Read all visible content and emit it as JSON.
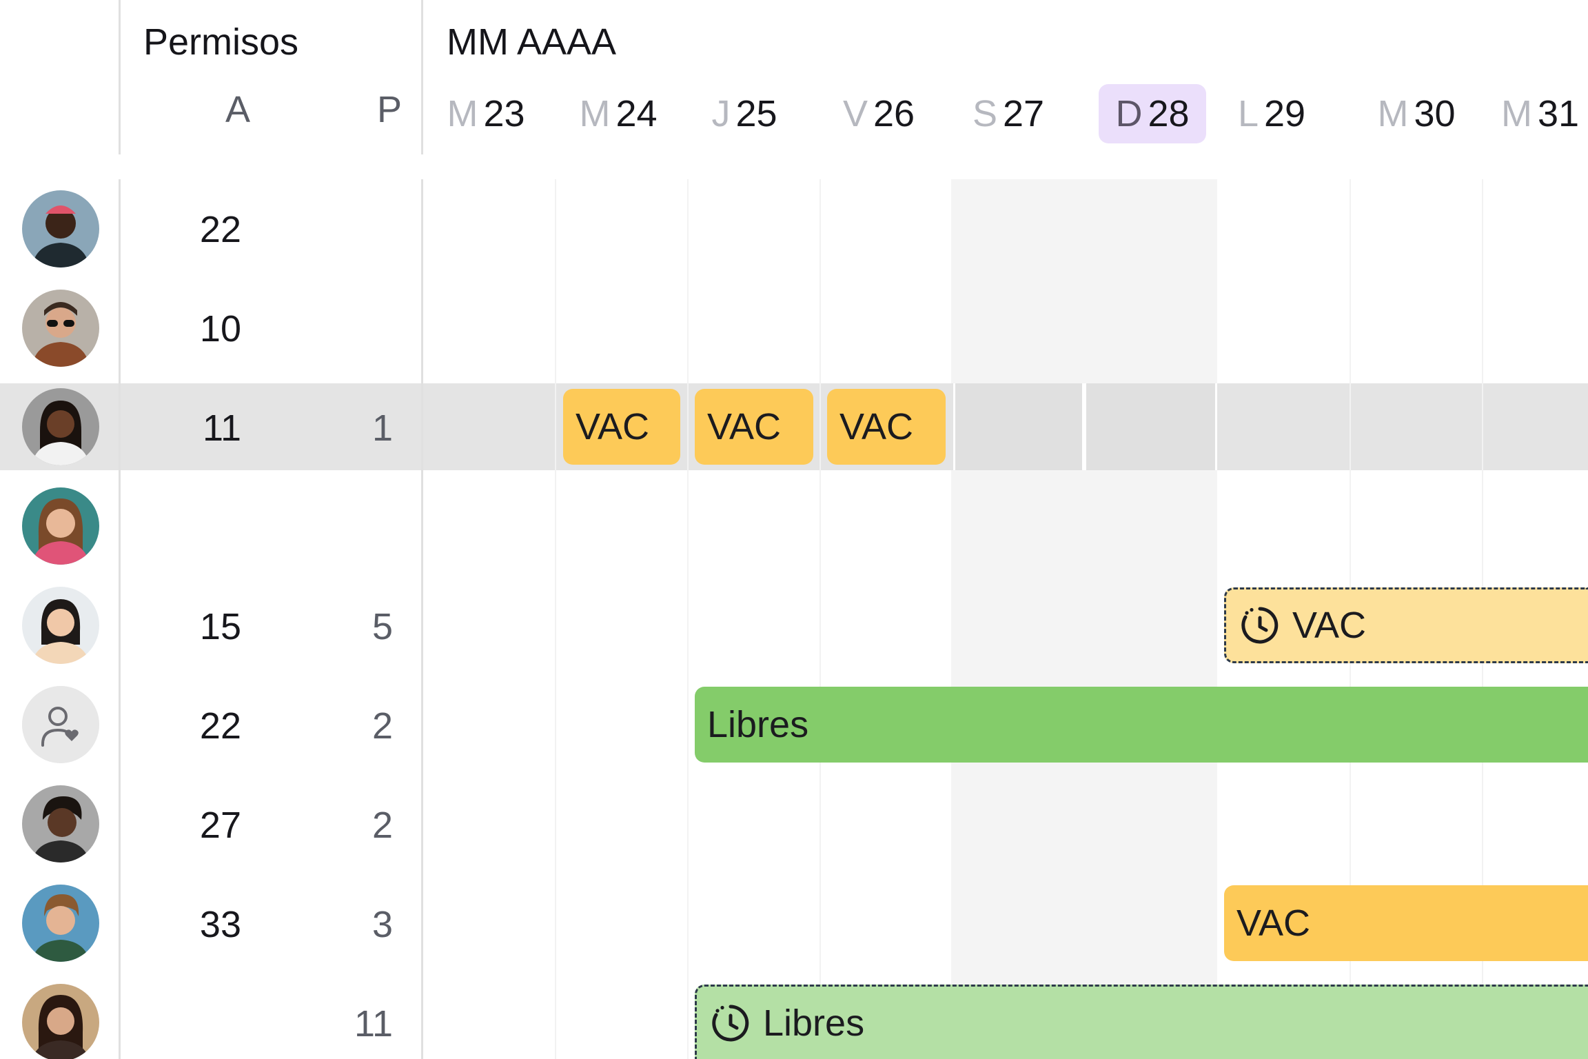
{
  "header": {
    "permisos_title": "Permisos",
    "month_title": "MM AAAA",
    "col_a": "A",
    "col_p": "P"
  },
  "days": [
    {
      "letter": "M",
      "num": "23",
      "today": false
    },
    {
      "letter": "M",
      "num": "24",
      "today": false
    },
    {
      "letter": "J",
      "num": "25",
      "today": false
    },
    {
      "letter": "V",
      "num": "26",
      "today": false
    },
    {
      "letter": "S",
      "num": "27",
      "today": false
    },
    {
      "letter": "D",
      "num": "28",
      "today": true
    },
    {
      "letter": "L",
      "num": "29",
      "today": false
    },
    {
      "letter": "M",
      "num": "30",
      "today": false
    },
    {
      "letter": "M",
      "num": "31",
      "today": false
    }
  ],
  "rows": [
    {
      "a": "22",
      "p": "",
      "avatar": "person-photo"
    },
    {
      "a": "10",
      "p": "",
      "avatar": "person-photo"
    },
    {
      "a": "11",
      "p": "1",
      "avatar": "person-photo",
      "highlighted": true
    },
    {
      "a": "",
      "p": "",
      "avatar": "person-photo"
    },
    {
      "a": "15",
      "p": "5",
      "avatar": "person-photo"
    },
    {
      "a": "22",
      "p": "2",
      "avatar": "user-heart-icon"
    },
    {
      "a": "27",
      "p": "2",
      "avatar": "person-photo"
    },
    {
      "a": "33",
      "p": "3",
      "avatar": "person-photo"
    },
    {
      "a": "",
      "p": "11",
      "avatar": "person-photo"
    }
  ],
  "events": {
    "vac_label": "VAC",
    "libres_label": "Libres"
  },
  "colors": {
    "vac": "#fdca58",
    "vac_pending": "#fde19b",
    "libres": "#84cc6a",
    "libres_pending": "#b4e0a5",
    "today_bg": "#ebdffb",
    "weekend_bg": "#f4f4f4",
    "highlight_row": "#e4e4e4"
  }
}
